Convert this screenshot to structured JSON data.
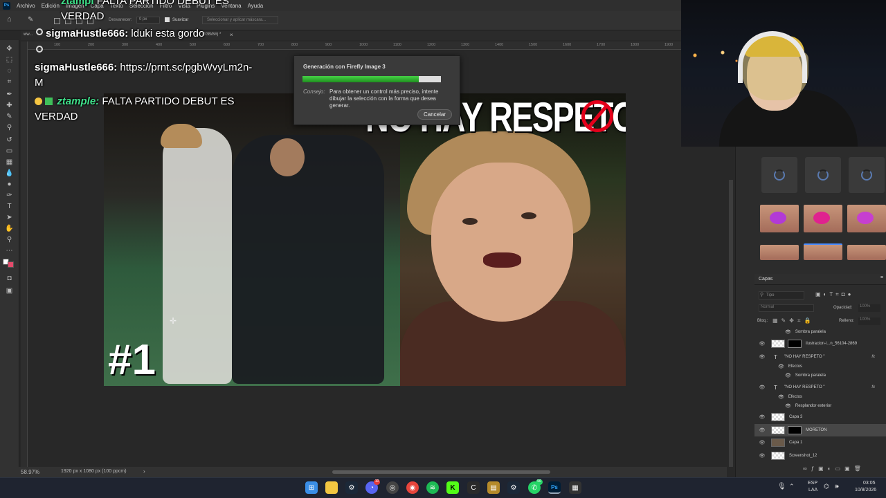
{
  "menubar": {
    "logo": "Ps",
    "items": [
      "Archivo",
      "Edición",
      "Imagen",
      "Capa",
      "Texto",
      "Selección",
      "Filtro",
      "Vista",
      "Plugins",
      "Ventana",
      "Ayuda"
    ]
  },
  "optionsbar": {
    "desvanecer_label": "Desvanecer:",
    "desvanecer_value": "0 px",
    "suavizar_label": "Suavizar",
    "select_mask_label": "Seleccionar y aplicar máscara..."
  },
  "document_tab": {
    "label": "ww...",
    "suffix": "RGB/8#) *",
    "close": "×"
  },
  "ruler": {
    "ticks": [
      "100",
      "200",
      "300",
      "400",
      "500",
      "600",
      "700",
      "800",
      "900",
      "1000",
      "1100",
      "1200",
      "1300",
      "1400",
      "1500",
      "1600",
      "1700",
      "1800",
      "1900",
      "20"
    ]
  },
  "chat": {
    "messages": [
      {
        "user": "ztampl",
        "text": "FALTA PARTIDO DEBUT ES VERDAD"
      },
      {
        "user": "sigmaHustle666:",
        "text": "lduki esta gordo"
      },
      {
        "user": "sigmaHustle666:",
        "text": "https://prnt.sc/pgbWvyLm2n-M"
      },
      {
        "user": "ztample:",
        "text": "FALTA PARTIDO DEBUT ES VERDAD"
      }
    ]
  },
  "artwork": {
    "headline": "NO HAY RESPETO",
    "quote_mark": "\"",
    "rank": "#1"
  },
  "dialog": {
    "title": "Generación con Firefly Image 3",
    "progress": 0.84,
    "tip_label": "Consejo:",
    "tip_text": "Para obtener un control más preciso, intente dibujar la selección con la forma que desea generar.",
    "cancel_label": "Cancelar"
  },
  "statusbar": {
    "zoom": "58.97%",
    "doc_info": "1920 px x 1080 px (100 ppcm)",
    "arrow": "›"
  },
  "layers_panel": {
    "title": "Capas",
    "search_placeholder": "Tipo",
    "blend_mode": "Normal",
    "opacity_label": "Opacidad:",
    "opacity_value": "100%",
    "lock_label": "Bloq.:",
    "fill_label": "Relleno:",
    "fill_value": "100%",
    "layers": [
      {
        "name": "Sombra paralela",
        "kind": "effect"
      },
      {
        "name": "ilustracion-i...n_56104-2869",
        "kind": "image-mask"
      },
      {
        "name": "\"NO HAY RESPETO \"",
        "kind": "text",
        "fx": "fx"
      },
      {
        "name": "Efectos",
        "kind": "effects-group"
      },
      {
        "name": "Sombra paralela",
        "kind": "effect"
      },
      {
        "name": "\"NO HAY RESPETO \"",
        "kind": "text",
        "fx": "fx"
      },
      {
        "name": "Efectos",
        "kind": "effects-group"
      },
      {
        "name": "Resplandor exterior",
        "kind": "effect"
      },
      {
        "name": "Capa 3",
        "kind": "image"
      },
      {
        "name": "MORETON",
        "kind": "image-mask",
        "selected": true
      },
      {
        "name": "Capa 1",
        "kind": "image"
      },
      {
        "name": "Screenshot_12",
        "kind": "image"
      }
    ]
  },
  "taskbar": {
    "icons": [
      "windows-icon",
      "file-explorer-icon",
      "steam-icon",
      "discord-icon",
      "chrome-alt-icon",
      "chrome-icon",
      "spotify-icon",
      "kick-icon",
      "ccleaner-icon",
      "winrar-icon",
      "steam-icon-2",
      "whatsapp-icon",
      "photoshop-icon",
      "game-icon"
    ],
    "discord_badge": "10",
    "whatsapp_badge": "56",
    "lang_top": "ESP",
    "lang_bottom": "LAA",
    "time": "03:05",
    "date": "10/8/2026"
  },
  "colors": {
    "accent": "#31a8ff",
    "progress_green": "#34b934",
    "ban_red": "#e4001b"
  }
}
